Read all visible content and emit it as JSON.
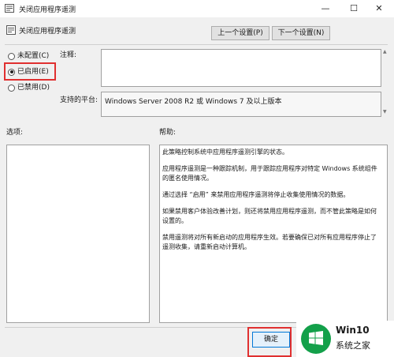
{
  "window": {
    "title": "关闭应用程序遥测",
    "minimize_glyph": "—",
    "maximize_glyph": "☐",
    "close_glyph": "✕"
  },
  "header": {
    "policy_name": "关闭应用程序遥测",
    "prev_button": "上一个设置(P)",
    "next_button": "下一个设置(N)"
  },
  "state_options": [
    {
      "label": "未配置(C)",
      "selected": false
    },
    {
      "label": "已启用(E)",
      "selected": true
    },
    {
      "label": "已禁用(D)",
      "selected": false
    }
  ],
  "comment": {
    "label": "注释:",
    "value": ""
  },
  "platform": {
    "label": "支持的平台:",
    "value": "Windows Server 2008 R2 或 Windows 7 及以上版本"
  },
  "options": {
    "label": "选项:"
  },
  "help": {
    "label": "帮助:",
    "paragraphs": [
      "此策略控制系统中应用程序遥测引擎的状态。",
      "应用程序遥测是一种跟踪机制，用于跟踪应用程序对特定 Windows 系统组件的匿名使用情况。",
      "通过选择 “启用” 来禁用应用程序遥测将停止收集使用情况的数据。",
      "如果禁用客户体验改善计划，则还将禁用应用程序遥测，而不管此策略是如何设置的。",
      "禁用遥测将对所有新启动的应用程序生效。若要确保已对所有应用程序停止了遥测收集，请重新启动计算机。"
    ]
  },
  "footer": {
    "ok_button": "确定"
  },
  "watermark": {
    "title": "Win10",
    "subtitle": "系统之家",
    "color": "#13a04a"
  },
  "colors": {
    "highlight": "#e03030",
    "background": "#f0f0f0"
  }
}
